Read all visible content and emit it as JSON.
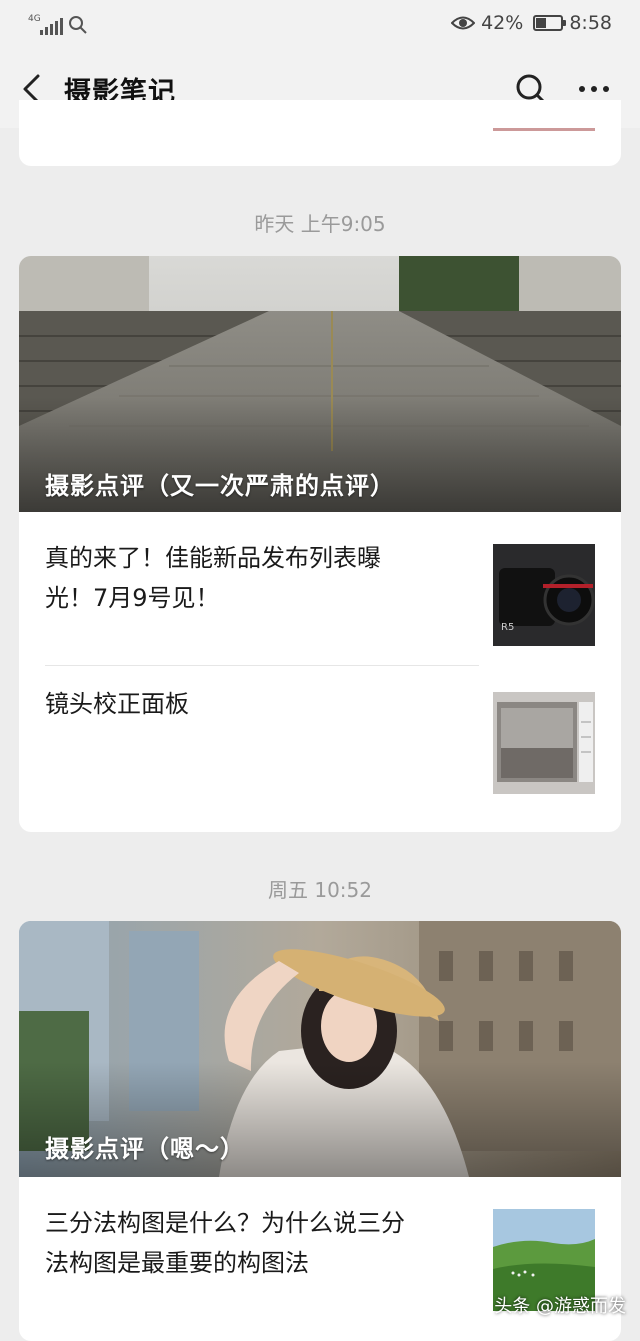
{
  "status_bar": {
    "network": "4G",
    "battery_percent": "42%",
    "battery_level": 0.42,
    "time": "8:58"
  },
  "header": {
    "title": "摄影笔记",
    "back_icon": "back-arrow-icon",
    "search_icon": "search-icon",
    "more_icon": "more-icon"
  },
  "groups": [
    {
      "timestamp": "昨天 上午9:05",
      "cover_title": "摄影点评（又一次严肃的点评）",
      "articles": [
        {
          "title_line1": "真的来了！佳能新品发布列表曝",
          "title_line2": "光！7月9号见！"
        },
        {
          "title_line1": "镜头校正面板",
          "title_line2": ""
        }
      ]
    },
    {
      "timestamp": "周五 10:52",
      "cover_title": "摄影点评（嗯～）",
      "articles": [
        {
          "title_line1": "三分法构图是什么？为什么说三分",
          "title_line2": "法构图是最重要的构图法"
        }
      ]
    }
  ],
  "watermark": "头条 @游惑而发"
}
